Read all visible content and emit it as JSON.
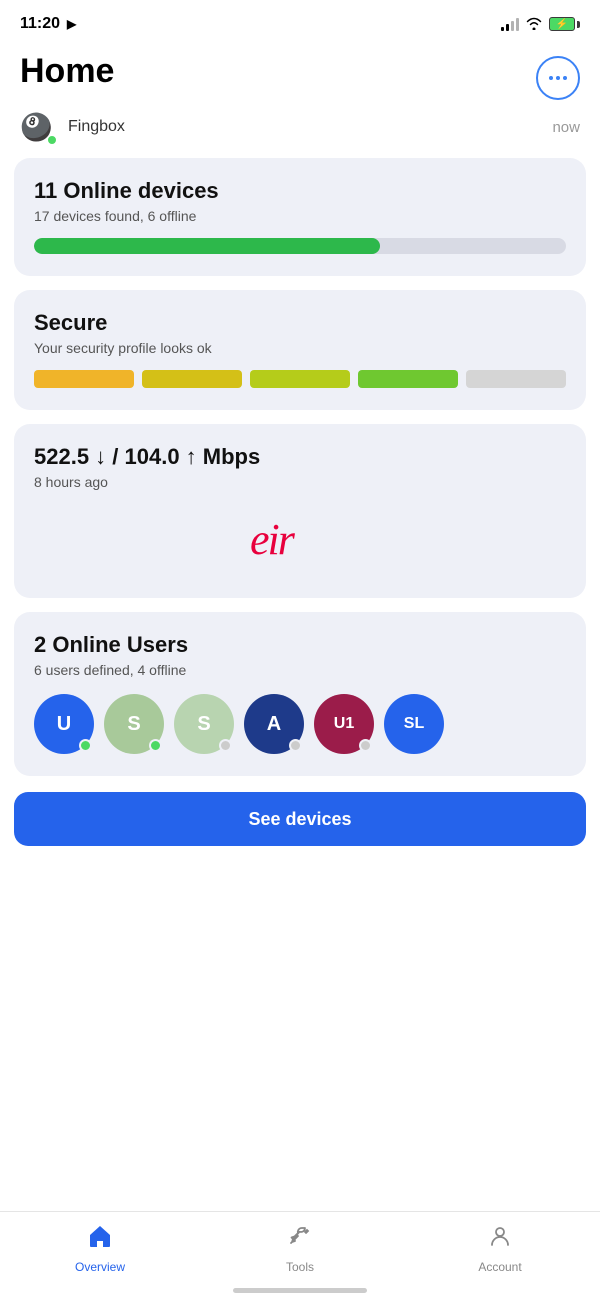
{
  "statusBar": {
    "time": "11:20",
    "navigationArrow": "▶"
  },
  "header": {
    "title": "Home",
    "moreButtonLabel": "···"
  },
  "fingbox": {
    "name": "Fingbox",
    "time": "now"
  },
  "devicesCard": {
    "title": "11 Online devices",
    "subtitle": "17 devices found, 6 offline",
    "onlineCount": 11,
    "totalCount": 17,
    "progressPercent": 65
  },
  "secureCard": {
    "title": "Secure",
    "subtitle": "Your security profile looks ok",
    "blocks": [
      {
        "color": "#f0b429"
      },
      {
        "color": "#d4c017"
      },
      {
        "color": "#b5cc1a"
      },
      {
        "color": "#6fc830"
      },
      {
        "color": "#d5d5d5"
      }
    ]
  },
  "speedCard": {
    "title": "522.5 ↓ / 104.0 ↑ Mbps",
    "subtitle": "8 hours ago",
    "ispLogoText": "eir"
  },
  "usersCard": {
    "title": "2 Online Users",
    "subtitle": "6 users defined, 4 offline",
    "users": [
      {
        "initials": "U",
        "color": "#2563eb",
        "online": true
      },
      {
        "initials": "S",
        "color": "#a8c99a",
        "online": true
      },
      {
        "initials": "S",
        "color": "#b8d4b0",
        "online": false
      },
      {
        "initials": "A",
        "color": "#1e3a8a",
        "online": false
      },
      {
        "initials": "U1",
        "color": "#9b1c4a",
        "online": false
      },
      {
        "initials": "SL",
        "color": "#2563eb",
        "online": false
      }
    ]
  },
  "seeDevicesButton": {
    "label": "See devices"
  },
  "bottomNav": {
    "items": [
      {
        "label": "Overview",
        "active": true
      },
      {
        "label": "Tools",
        "active": false
      },
      {
        "label": "Account",
        "active": false
      }
    ]
  }
}
